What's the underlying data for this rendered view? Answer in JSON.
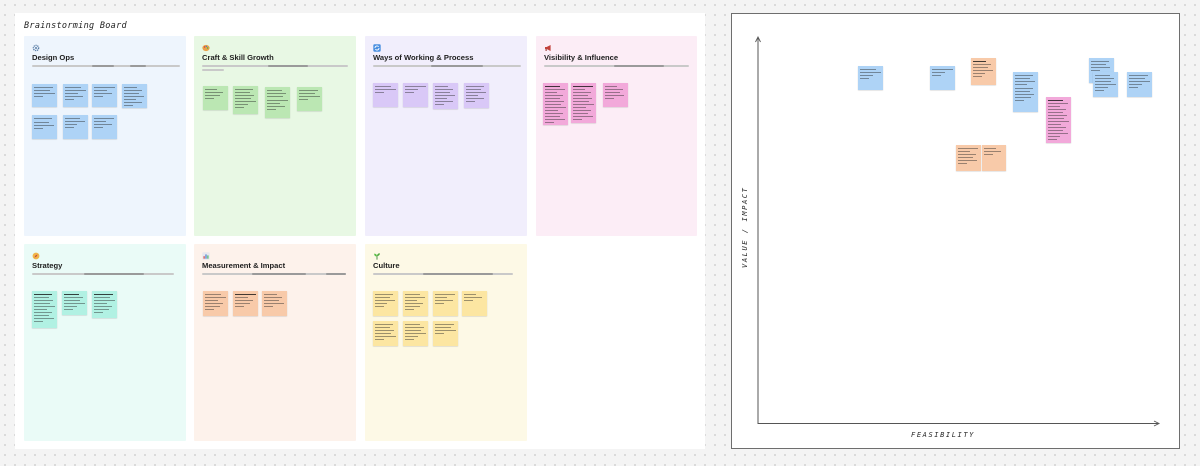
{
  "board": {
    "title": "Brainstorming Board"
  },
  "sections": [
    {
      "title": "Design Ops",
      "icon": "gear-icon",
      "background": "#eef5fd"
    },
    {
      "title": "Craft & Skill Growth",
      "icon": "palette-icon",
      "background": "#e8f8e4"
    },
    {
      "title": "Ways of Working & Process",
      "icon": "arrows-cycle-icon",
      "background": "#f1eefc"
    },
    {
      "title": "Visibility & Influence",
      "icon": "megaphone-icon",
      "background": "#fcedf6"
    },
    {
      "title": "Strategy",
      "icon": "compass-icon",
      "background": "#eafbf7"
    },
    {
      "title": "Measurement & Impact",
      "icon": "bar-chart-icon",
      "background": "#fdf2eb"
    },
    {
      "title": "Culture",
      "icon": "seedling-icon",
      "background": "#fdf9e6"
    }
  ],
  "sticky_colors": {
    "blue": "#aed3f6",
    "green": "#bbe7b3",
    "lavender": "#d9c8f7",
    "pink": "#f2a9da",
    "mint": "#b1f1e3",
    "peach": "#f8caa9",
    "yellow": "#fce6a2"
  },
  "matrix": {
    "y_axis_label": "VALUE / IMPACT",
    "x_axis_label": "FEASIBILITY"
  }
}
